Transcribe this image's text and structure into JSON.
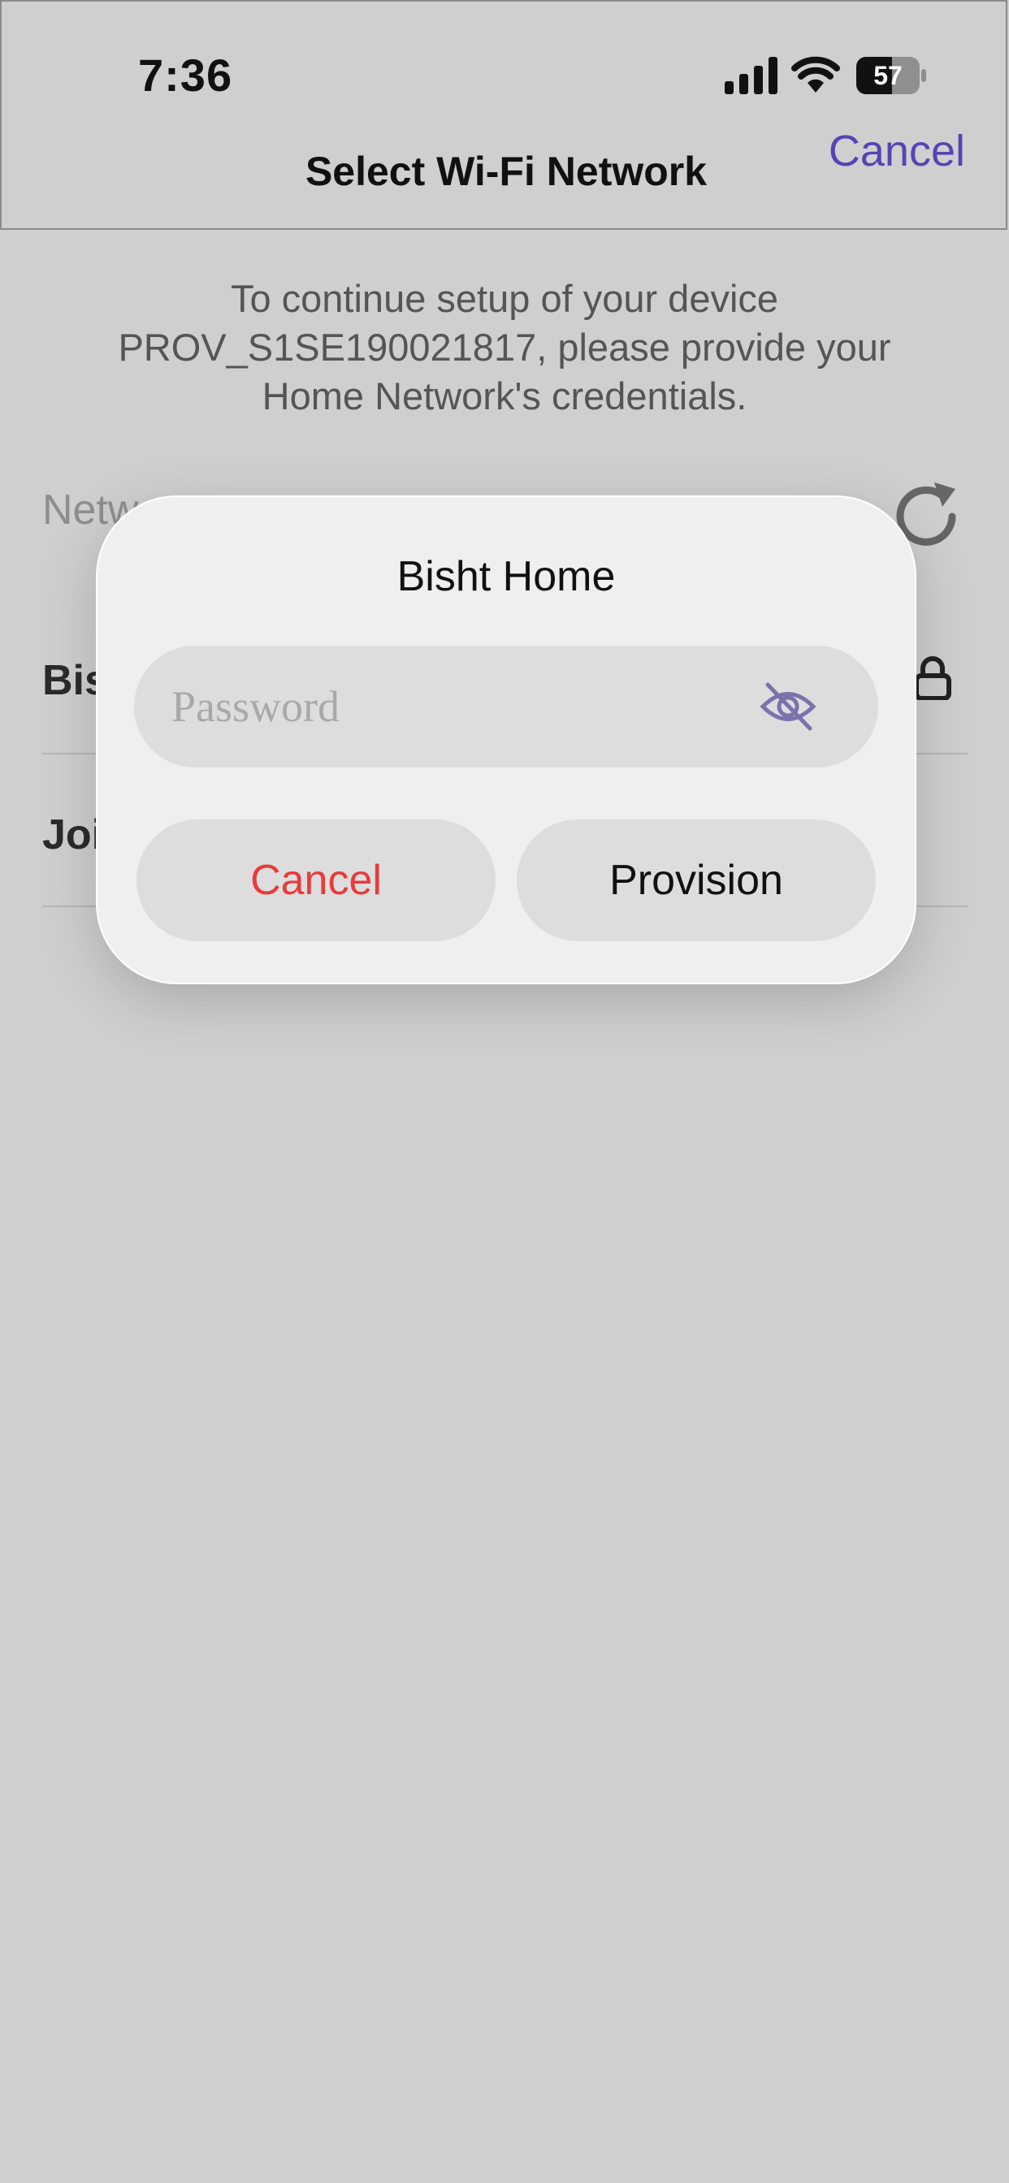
{
  "status_bar": {
    "time": "7:36",
    "battery": "57",
    "signal_icon": "cellular-signal-icon",
    "wifi_icon": "wifi-icon",
    "battery_icon": "battery-icon"
  },
  "nav": {
    "title": "Select Wi-Fi Network",
    "cancel_label": "Cancel"
  },
  "intro_text": "To continue setup of your device PROV_S1SE190021817, please provide your Home Network's credentials.",
  "network_list": {
    "label": "Netw",
    "refresh_icon": "refresh-icon",
    "rows": [
      {
        "label": "Bis",
        "icon": "lock-icon"
      },
      {
        "label": "Joi"
      }
    ]
  },
  "dialog": {
    "title": "Bisht Home",
    "password_placeholder": "Password",
    "password_value": "",
    "toggle_icon": "eye-slash-icon",
    "cancel_label": "Cancel",
    "provision_label": "Provision"
  },
  "colors": {
    "accent": "#5843b4",
    "destructive": "#ea3a3a",
    "background": "#cfcfcf",
    "dialog_bg": "#efefef"
  }
}
